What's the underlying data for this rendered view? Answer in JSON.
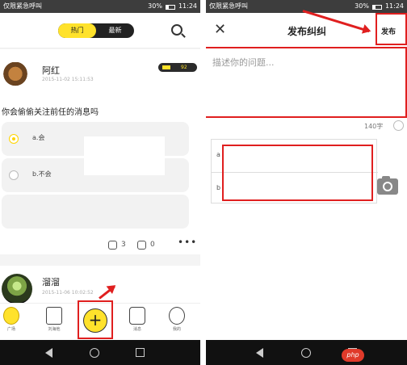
{
  "left_phone": {
    "status": {
      "carrier": "仅限紧急呼叫",
      "battery": "30%",
      "time": "11:24"
    },
    "tabs": [
      {
        "label": "热门"
      },
      {
        "label": "最新"
      }
    ],
    "post1": {
      "username": "阿红",
      "time": "2015-11-02 15:11:53",
      "level": "92",
      "question": "你会偷偷关注前任的消息吗",
      "options": [
        {
          "label": "a.会"
        },
        {
          "label": "b.不会"
        }
      ],
      "comments": "3",
      "shares": "0",
      "more": "•••"
    },
    "post2": {
      "username": "溜溜",
      "time": "2015-11-06 10:02:52"
    },
    "bottom_tabs": [
      {
        "label": "广场"
      },
      {
        "label": "刘海他"
      },
      {
        "label": ""
      },
      {
        "label": "消息"
      },
      {
        "label": "我的"
      }
    ],
    "plus_symbol": "+"
  },
  "right_phone": {
    "status": {
      "carrier": "仅限紧急呼叫",
      "battery": "30%",
      "time": "11:24"
    },
    "title": "发布纠纠",
    "publish_label": "发布",
    "close_symbol": "✕",
    "description_placeholder": "描述你的问题...",
    "char_count": "140字",
    "option_tags": [
      "a",
      "b"
    ]
  },
  "watermark": "php",
  "colors": {
    "accent": "#ffe22b",
    "highlight": "#e01f1f",
    "statusbar": "#3d3d3d"
  }
}
